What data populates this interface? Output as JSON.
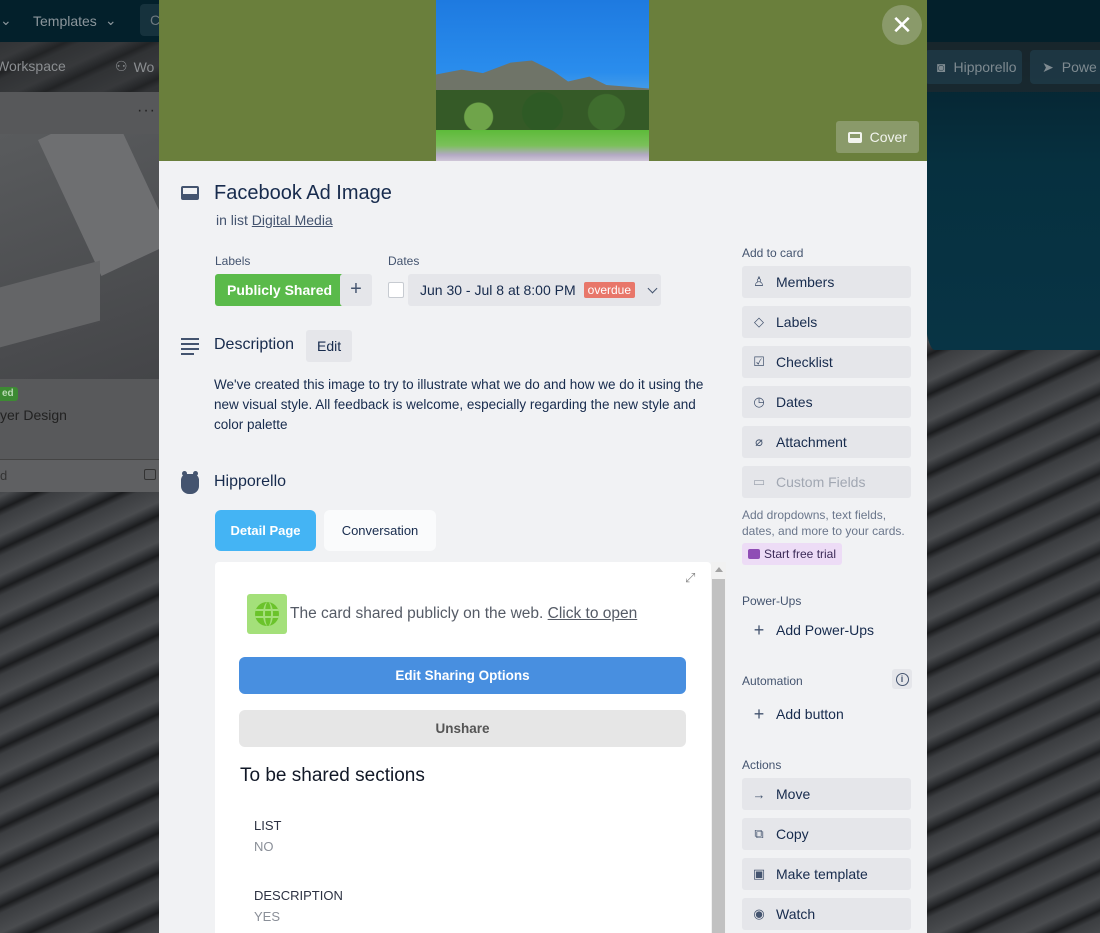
{
  "background": {
    "topbar": {
      "partial_item": "",
      "templates_label": "Templates",
      "search_stub": "C"
    },
    "boardbar": {
      "workspace_label": "Workspace",
      "workspace_partial": "Wo",
      "hipporello_label": "Hipporello",
      "powerups_partial": "Powe"
    },
    "list": {
      "menu": "···",
      "card_label_partial": "ed",
      "card_title_partial": "yer Design",
      "footer_partial": "d"
    }
  },
  "modal": {
    "close_label": "✕",
    "cover_button": "Cover",
    "card_title": "Facebook Ad Image",
    "in_list_prefix": "in list",
    "list_name": "Digital Media",
    "labels_heading": "Labels",
    "label_chip": "Publicly Shared",
    "label_color": "#5aba4a",
    "add_label": "+",
    "dates_heading": "Dates",
    "date_range": "Jun 30 - Jul 8 at 8:00 PM",
    "date_status": "overdue",
    "date_status_color": "#e8776a",
    "description_heading": "Description",
    "edit_label": "Edit",
    "description_text": "We've created this image to try to illustrate what we do and how we do it using the new visual style. All feedback is welcome, especially regarding the new style and color palette",
    "powerup_heading": "Hipporello",
    "tabs": [
      {
        "label": "Detail Page",
        "active": true
      },
      {
        "label": "Conversation",
        "active": false
      }
    ],
    "iframe": {
      "share_message": "The card shared publicly on the web.",
      "share_link": "Click to open",
      "edit_sharing_button": "Edit Sharing Options",
      "unshare_button": "Unshare",
      "sections_heading": "To be shared sections",
      "sections": [
        {
          "key": "LIST",
          "value": "NO"
        },
        {
          "key": "DESCRIPTION",
          "value": "YES"
        }
      ]
    }
  },
  "sidebar": {
    "add_to_card_heading": "Add to card",
    "add_to_card": [
      {
        "label": "Members",
        "icon": "member-icon",
        "glyph": "♙"
      },
      {
        "label": "Labels",
        "icon": "label-icon",
        "glyph": "◇"
      },
      {
        "label": "Checklist",
        "icon": "checklist-icon",
        "glyph": "☑"
      },
      {
        "label": "Dates",
        "icon": "clock-icon",
        "glyph": "◷"
      },
      {
        "label": "Attachment",
        "icon": "paperclip-icon",
        "glyph": "⌀"
      },
      {
        "label": "Custom Fields",
        "icon": "custom-fields-icon",
        "glyph": "▭",
        "disabled": true
      }
    ],
    "custom_fields_note": "Add dropdowns, text fields, dates, and more to your cards.",
    "start_trial": "Start free trial",
    "powerups_heading": "Power-Ups",
    "add_powerups": "Add Power-Ups",
    "automation_heading": "Automation",
    "info_glyph": "i",
    "add_button": "Add button",
    "actions_heading": "Actions",
    "actions": [
      {
        "label": "Move",
        "icon": "arrow-right-icon",
        "glyph": "→"
      },
      {
        "label": "Copy",
        "icon": "copy-icon",
        "glyph": "⧉"
      },
      {
        "label": "Make template",
        "icon": "template-icon",
        "glyph": "▣"
      },
      {
        "label": "Watch",
        "icon": "eye-icon",
        "glyph": "◉"
      }
    ]
  }
}
